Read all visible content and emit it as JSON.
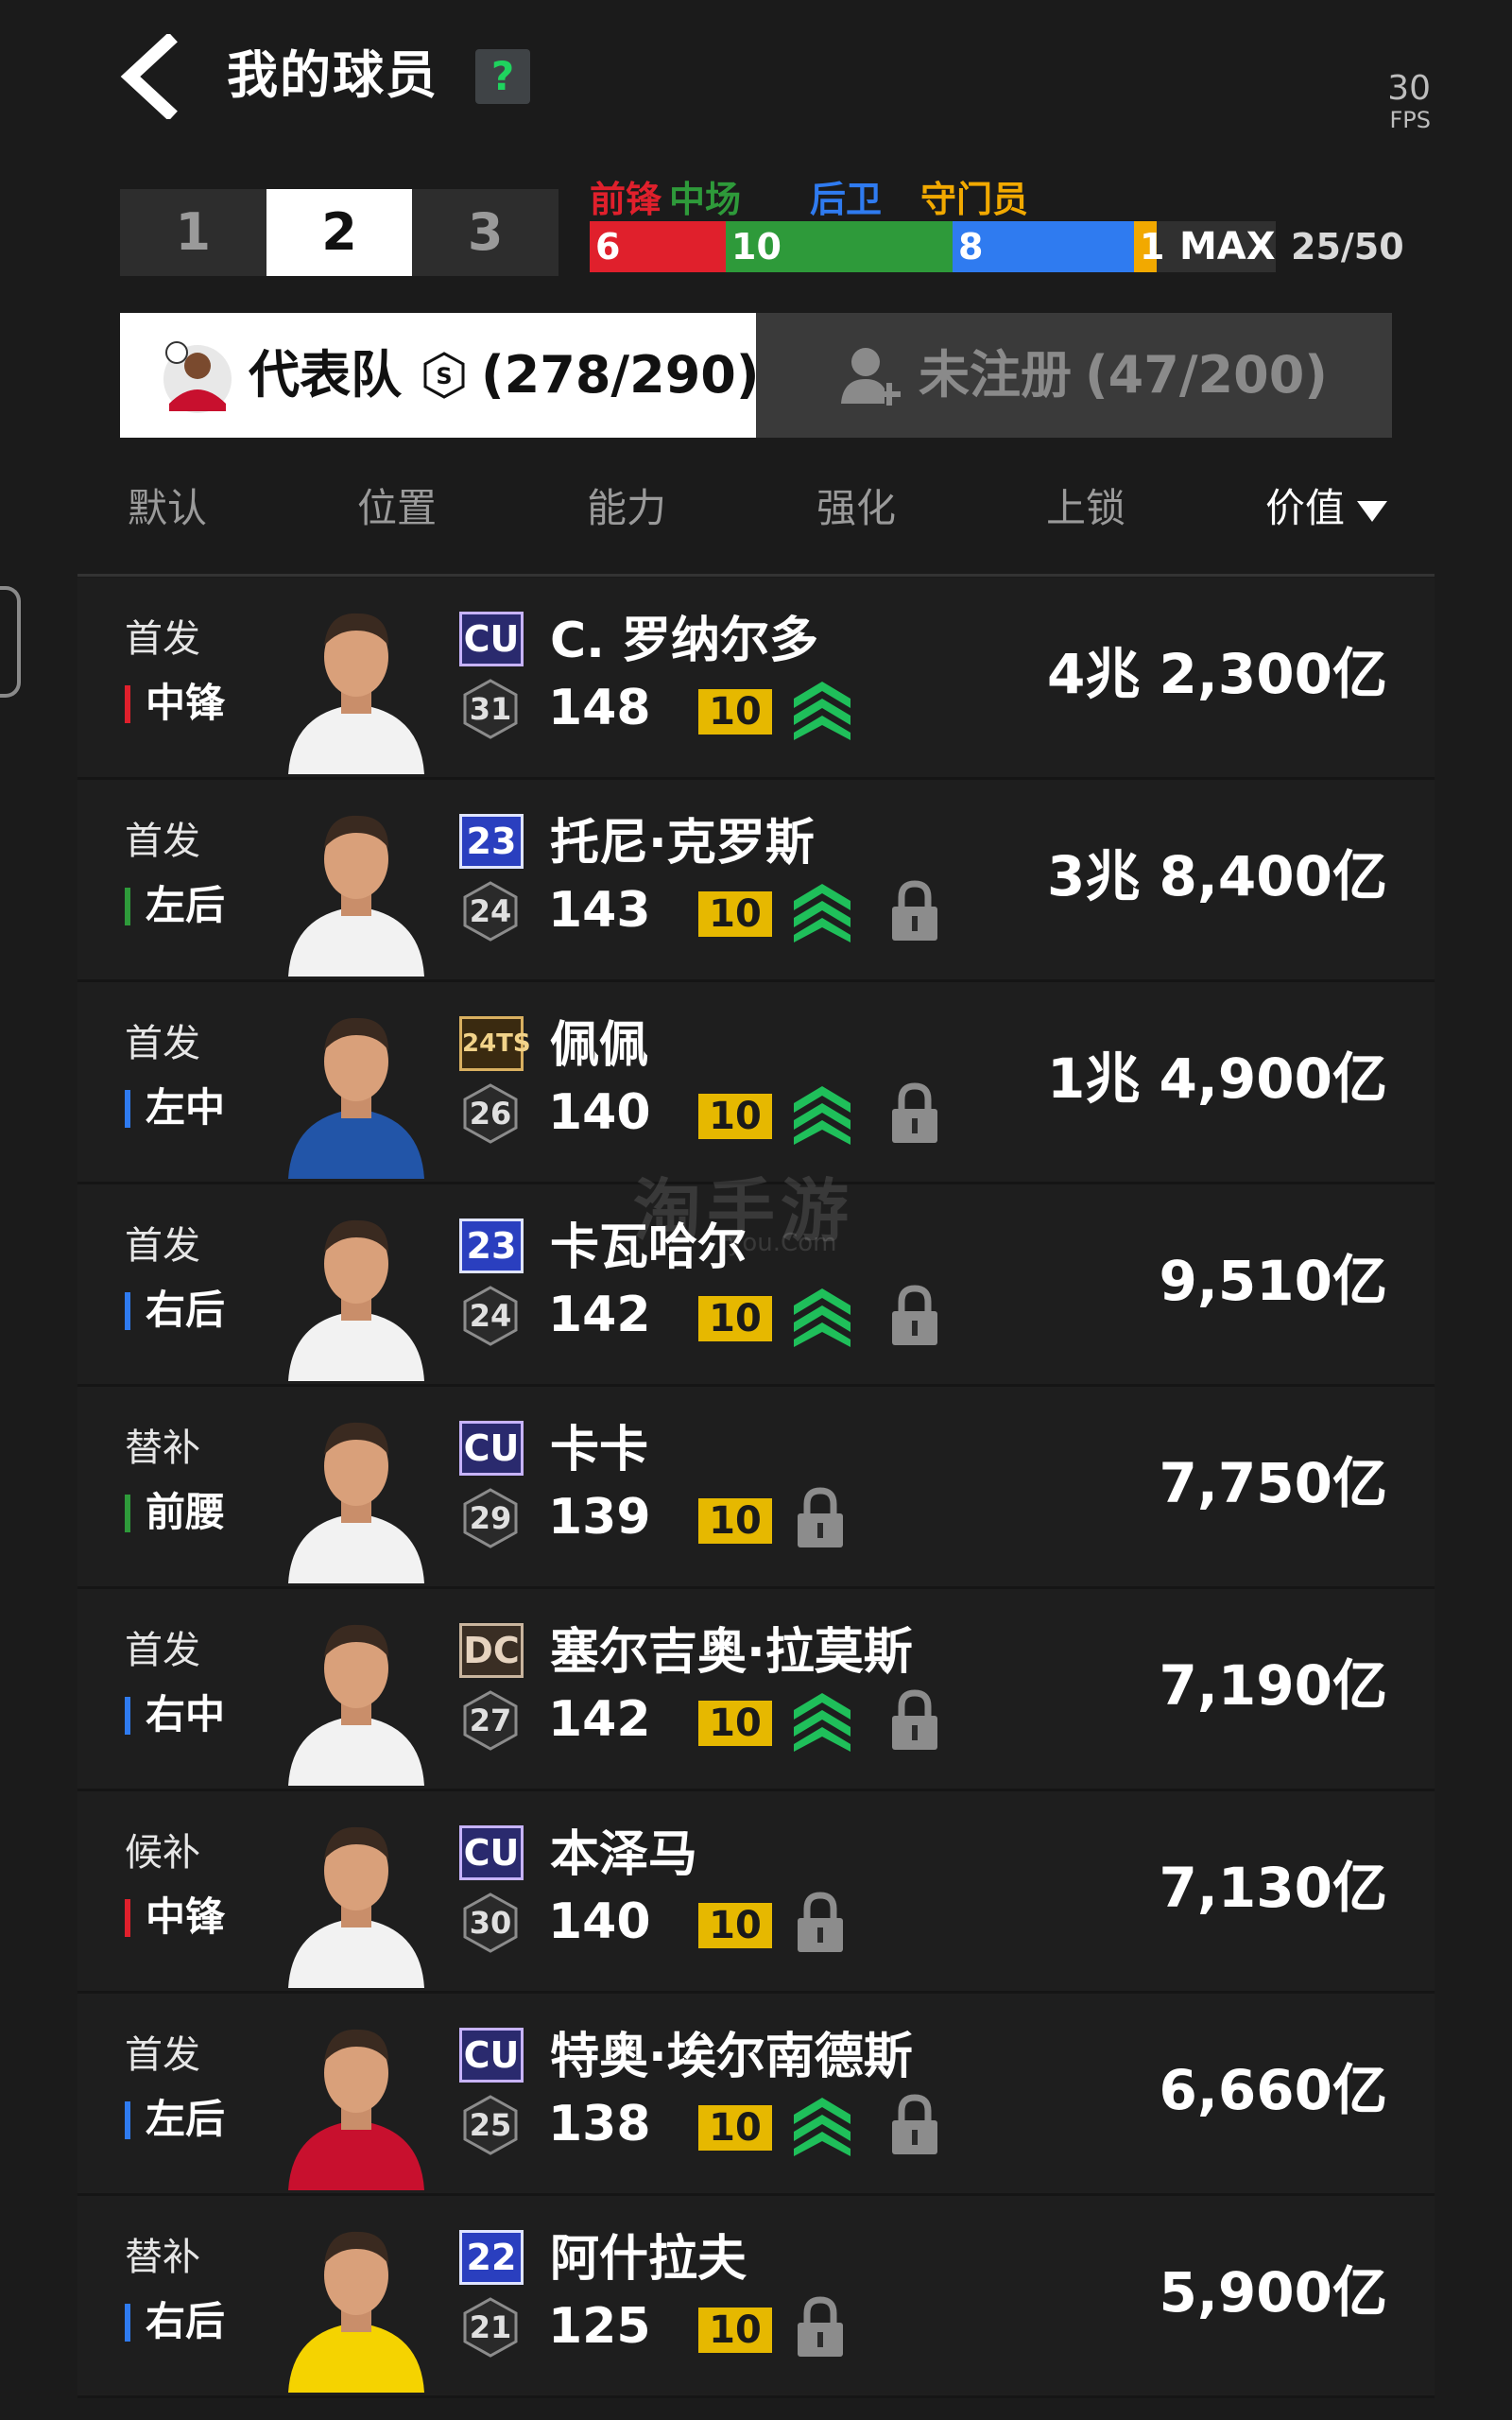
{
  "header": {
    "title": "我的球员",
    "help_label": "?",
    "fps_value": "30",
    "fps_unit": "FPS"
  },
  "page_tabs": [
    "1",
    "2",
    "3"
  ],
  "active_page_tab": "2",
  "position_filter": {
    "labels": [
      {
        "text": "前锋",
        "color": "#e0202c"
      },
      {
        "text": "中场",
        "color": "#2e9a3a"
      },
      {
        "text": "后卫",
        "color": "#2f7bf0"
      },
      {
        "text": "守门员",
        "color": "#f2a900"
      }
    ],
    "counts": [
      {
        "label": "6",
        "value": 6,
        "color": "#e0202c"
      },
      {
        "label": "10",
        "value": 10,
        "color": "#2e9a3a"
      },
      {
        "label": "8",
        "value": 8,
        "color": "#2f7bf0"
      },
      {
        "label": "1",
        "value": 1,
        "color": "#f2a900"
      }
    ],
    "max_label": "MAX",
    "count_text": "25/50"
  },
  "squad_tabs": {
    "active": {
      "label": "代表队",
      "coin_icon_label": "S",
      "count": "(278/290)"
    },
    "inactive": {
      "label": "未注册",
      "count": "(47/200)",
      "icon": "add-user-icon"
    }
  },
  "sort_options": [
    "默认",
    "位置",
    "能力",
    "强化",
    "上锁",
    "价值"
  ],
  "active_sort": "价值",
  "position_colors": {
    "forward": "#e0202c",
    "midfield": "#2e9a3a",
    "defender": "#2f7bf0"
  },
  "players": [
    {
      "status": "首发",
      "position": "中锋",
      "pos_group": "forward",
      "badge": "CU",
      "badge_style": "cu",
      "level": "31",
      "name": "C. 罗纳尔多",
      "ovr": "148",
      "boost": "10",
      "upgraded": true,
      "locked": false,
      "value": "4兆 2,300亿"
    },
    {
      "status": "首发",
      "position": "左后",
      "pos_group": "midfield",
      "badge": "23",
      "badge_style": "num",
      "level": "24",
      "name": "托尼·克罗斯",
      "ovr": "143",
      "boost": "10",
      "upgraded": true,
      "locked": true,
      "value": "3兆 8,400亿"
    },
    {
      "status": "首发",
      "position": "左中",
      "pos_group": "defender",
      "badge": "24TS",
      "badge_style": "ts",
      "level": "26",
      "name": "佩佩",
      "ovr": "140",
      "boost": "10",
      "upgraded": true,
      "locked": true,
      "value": "1兆 4,900亿"
    },
    {
      "status": "首发",
      "position": "右后",
      "pos_group": "defender",
      "badge": "23",
      "badge_style": "num",
      "level": "24",
      "name": "卡瓦哈尔",
      "ovr": "142",
      "boost": "10",
      "upgraded": true,
      "locked": true,
      "value": "9,510亿"
    },
    {
      "status": "替补",
      "position": "前腰",
      "pos_group": "midfield",
      "badge": "CU",
      "badge_style": "cu",
      "level": "29",
      "name": "卡卡",
      "ovr": "139",
      "boost": "10",
      "upgraded": false,
      "locked": true,
      "value": "7,750亿"
    },
    {
      "status": "首发",
      "position": "右中",
      "pos_group": "defender",
      "badge": "DC",
      "badge_style": "dc",
      "level": "27",
      "name": "塞尔吉奥·拉莫斯",
      "ovr": "142",
      "boost": "10",
      "upgraded": true,
      "locked": true,
      "value": "7,190亿"
    },
    {
      "status": "候补",
      "position": "中锋",
      "pos_group": "forward",
      "badge": "CU",
      "badge_style": "cu",
      "level": "30",
      "name": "本泽马",
      "ovr": "140",
      "boost": "10",
      "upgraded": false,
      "locked": true,
      "value": "7,130亿"
    },
    {
      "status": "首发",
      "position": "左后",
      "pos_group": "defender",
      "badge": "CU",
      "badge_style": "cu",
      "level": "25",
      "name": "特奥·埃尔南德斯",
      "ovr": "138",
      "boost": "10",
      "upgraded": true,
      "locked": true,
      "value": "6,660亿"
    },
    {
      "status": "替补",
      "position": "右后",
      "pos_group": "defender",
      "badge": "22",
      "badge_style": "num",
      "level": "21",
      "name": "阿什拉夫",
      "ovr": "125",
      "boost": "10",
      "upgraded": false,
      "locked": true,
      "value": "5,900亿"
    }
  ],
  "jersey_colors": [
    "#f2f2f2",
    "#f2f2f2",
    "#2255a8",
    "#f2f2f2",
    "#f2f2f2",
    "#f2f2f2",
    "#f2f2f2",
    "#c8102e",
    "#f5d300"
  ],
  "watermark": {
    "main": "淘手游",
    "sub": "you.Com"
  }
}
